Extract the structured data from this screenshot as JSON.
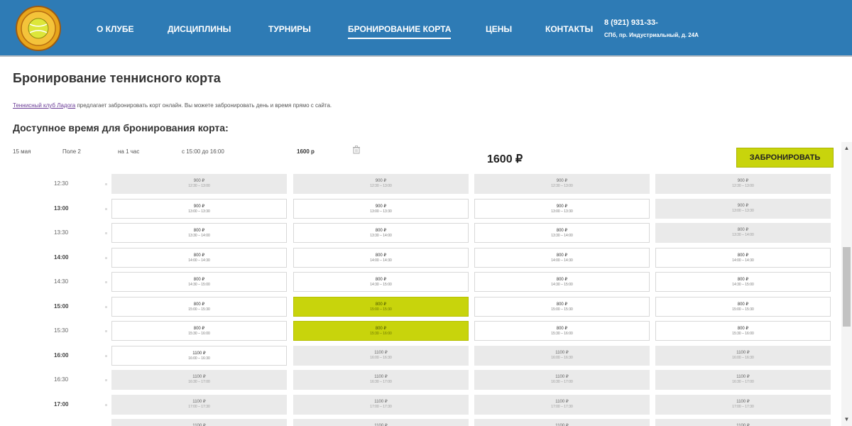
{
  "colors": {
    "header_bg": "#2e7bb5",
    "accent": "#c8d40c",
    "slot_available": "#ffffff",
    "slot_unavailable": "#eaeaea"
  },
  "nav": {
    "logo_icon": "tennis-club-logo",
    "items": [
      {
        "label": "О КЛУБЕ",
        "active": false
      },
      {
        "label": "ДИСЦИПЛИНЫ",
        "active": false
      },
      {
        "label": "ТУРНИРЫ",
        "active": false
      },
      {
        "label": "БРОНИРОВАНИЕ КОРТА",
        "active": true
      },
      {
        "label": "ЦЕНЫ",
        "active": false
      },
      {
        "label": "КОНТАКТЫ",
        "active": false
      }
    ],
    "phone": "8 (921) 931-33-",
    "address": "СПб, пр. Индустриальный, д. 24А"
  },
  "page": {
    "title": "Бронирование теннисного корта",
    "intro_link": "Теннисный клуб Ладога",
    "intro_text": " предлагает забронировать корт онлайн. Вы можете забронировать день и время прямо с сайта.",
    "schedule_title": "Доступное время для бронирования корта:"
  },
  "selection": {
    "date": "15 мая",
    "court": "Поле 2",
    "duration": "на 1 час",
    "time": "с 15:00 до 16:00",
    "price": "1600 р",
    "trash_icon": "trash-icon"
  },
  "summary": {
    "total": "1600 ₽",
    "book_label": "ЗАБРОНИРОВАТЬ"
  },
  "schedule": [
    {
      "time": "12:30",
      "slots": [
        {
          "price": "900 ₽",
          "range": "12:30 – 13:00",
          "state": "unavailable"
        },
        {
          "price": "900 ₽",
          "range": "12:30 – 13:00",
          "state": "unavailable"
        },
        {
          "price": "900 ₽",
          "range": "12:30 – 13:00",
          "state": "unavailable"
        },
        {
          "price": "900 ₽",
          "range": "12:30 – 13:00",
          "state": "unavailable"
        }
      ]
    },
    {
      "time": "13:00",
      "slots": [
        {
          "price": "900 ₽",
          "range": "13:00 – 13:30",
          "state": "available"
        },
        {
          "price": "900 ₽",
          "range": "13:00 – 13:30",
          "state": "available"
        },
        {
          "price": "900 ₽",
          "range": "13:00 – 13:30",
          "state": "available"
        },
        {
          "price": "900 ₽",
          "range": "13:00 – 13:30",
          "state": "unavailable"
        }
      ]
    },
    {
      "time": "13:30",
      "slots": [
        {
          "price": "800 ₽",
          "range": "13:30 – 14:00",
          "state": "available"
        },
        {
          "price": "800 ₽",
          "range": "13:30 – 14:00",
          "state": "available"
        },
        {
          "price": "800 ₽",
          "range": "13:30 – 14:00",
          "state": "available"
        },
        {
          "price": "800 ₽",
          "range": "13:30 – 14:00",
          "state": "unavailable"
        }
      ]
    },
    {
      "time": "14:00",
      "slots": [
        {
          "price": "800 ₽",
          "range": "14:00 – 14:30",
          "state": "available"
        },
        {
          "price": "800 ₽",
          "range": "14:00 – 14:30",
          "state": "available"
        },
        {
          "price": "800 ₽",
          "range": "14:00 – 14:30",
          "state": "available"
        },
        {
          "price": "800 ₽",
          "range": "14:00 – 14:30",
          "state": "available"
        }
      ]
    },
    {
      "time": "14:30",
      "slots": [
        {
          "price": "800 ₽",
          "range": "14:30 – 15:00",
          "state": "available"
        },
        {
          "price": "800 ₽",
          "range": "14:30 – 15:00",
          "state": "available"
        },
        {
          "price": "800 ₽",
          "range": "14:30 – 15:00",
          "state": "available"
        },
        {
          "price": "800 ₽",
          "range": "14:30 – 15:00",
          "state": "available"
        }
      ]
    },
    {
      "time": "15:00",
      "slots": [
        {
          "price": "800 ₽",
          "range": "15:00 – 15:30",
          "state": "available"
        },
        {
          "price": "800 ₽",
          "range": "15:00 – 15:30",
          "state": "selected"
        },
        {
          "price": "800 ₽",
          "range": "15:00 – 15:30",
          "state": "available"
        },
        {
          "price": "800 ₽",
          "range": "15:00 – 15:30",
          "state": "available"
        }
      ]
    },
    {
      "time": "15:30",
      "slots": [
        {
          "price": "800 ₽",
          "range": "15:30 – 16:00",
          "state": "available"
        },
        {
          "price": "800 ₽",
          "range": "15:30 – 16:00",
          "state": "selected"
        },
        {
          "price": "800 ₽",
          "range": "15:30 – 16:00",
          "state": "available"
        },
        {
          "price": "800 ₽",
          "range": "15:30 – 16:00",
          "state": "available"
        }
      ]
    },
    {
      "time": "16:00",
      "slots": [
        {
          "price": "1100 ₽",
          "range": "16:00 – 16:30",
          "state": "available"
        },
        {
          "price": "1100 ₽",
          "range": "16:00 – 16:30",
          "state": "unavailable"
        },
        {
          "price": "1100 ₽",
          "range": "16:00 – 16:30",
          "state": "unavailable"
        },
        {
          "price": "1100 ₽",
          "range": "16:00 – 16:30",
          "state": "unavailable"
        }
      ]
    },
    {
      "time": "16:30",
      "slots": [
        {
          "price": "1100 ₽",
          "range": "16:30 – 17:00",
          "state": "unavailable"
        },
        {
          "price": "1100 ₽",
          "range": "16:30 – 17:00",
          "state": "unavailable"
        },
        {
          "price": "1100 ₽",
          "range": "16:30 – 17:00",
          "state": "unavailable"
        },
        {
          "price": "1100 ₽",
          "range": "16:30 – 17:00",
          "state": "unavailable"
        }
      ]
    },
    {
      "time": "17:00",
      "slots": [
        {
          "price": "1100 ₽",
          "range": "17:00 – 17:30",
          "state": "unavailable"
        },
        {
          "price": "1100 ₽",
          "range": "17:00 – 17:30",
          "state": "unavailable"
        },
        {
          "price": "1100 ₽",
          "range": "17:00 – 17:30",
          "state": "unavailable"
        },
        {
          "price": "1100 ₽",
          "range": "17:00 – 17:30",
          "state": "unavailable"
        }
      ]
    },
    {
      "time": "",
      "slots": [
        {
          "price": "1100 ₽",
          "range": "",
          "state": "unavailable"
        },
        {
          "price": "1100 ₽",
          "range": "",
          "state": "unavailable"
        },
        {
          "price": "1100 ₽",
          "range": "",
          "state": "unavailable"
        },
        {
          "price": "1100 ₽",
          "range": "",
          "state": "unavailable"
        }
      ]
    }
  ],
  "scrollbar": {
    "up_icon": "scroll-up-arrow-icon",
    "down_icon": "scroll-down-arrow-icon"
  }
}
